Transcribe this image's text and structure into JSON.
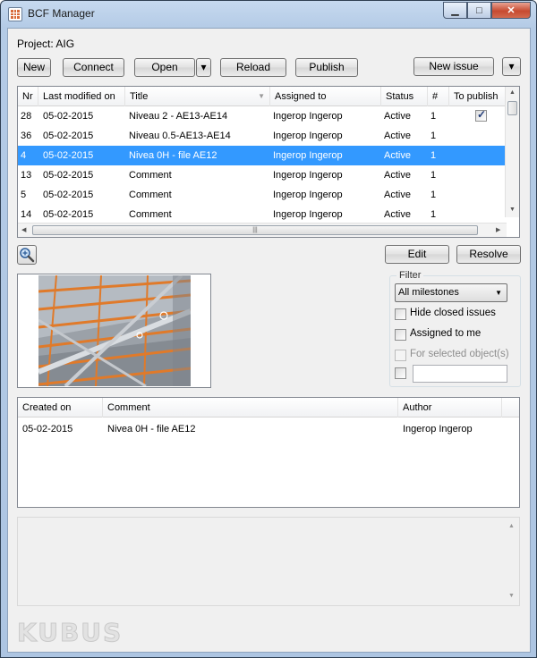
{
  "window": {
    "title": "BCF Manager",
    "icon": "app-grid-icon",
    "controls": {
      "minimize": "▁",
      "maximize": "□",
      "close": "✕"
    }
  },
  "project_label": "Project: AIG",
  "toolbar": {
    "new": "New",
    "connect": "Connect",
    "open": "Open",
    "open_dropdown": "▾",
    "reload": "Reload",
    "publish": "Publish",
    "new_issue": "New issue",
    "more": "▾"
  },
  "issues": {
    "columns": [
      "Nr",
      "Last modified on",
      "Title",
      "Assigned to",
      "Status",
      "#",
      "To publish"
    ],
    "sort_indicator": "▼",
    "rows": [
      {
        "nr": "28",
        "modified": "05-02-2015",
        "title": "Niveau 2 - AE13-AE14",
        "assigned": "Ingerop Ingerop",
        "status": "Active",
        "count": "1",
        "to_publish": true,
        "selected": false
      },
      {
        "nr": "36",
        "modified": "05-02-2015",
        "title": "Niveau 0.5-AE13-AE14",
        "assigned": "Ingerop Ingerop",
        "status": "Active",
        "count": "1",
        "to_publish": false,
        "selected": false
      },
      {
        "nr": "4",
        "modified": "05-02-2015",
        "title": "Nivea 0H - file AE12",
        "assigned": "Ingerop Ingerop",
        "status": "Active",
        "count": "1",
        "to_publish": false,
        "selected": true
      },
      {
        "nr": "13",
        "modified": "05-02-2015",
        "title": "Comment",
        "assigned": "Ingerop Ingerop",
        "status": "Active",
        "count": "1",
        "to_publish": false,
        "selected": false
      },
      {
        "nr": "5",
        "modified": "05-02-2015",
        "title": "Comment",
        "assigned": "Ingerop Ingerop",
        "status": "Active",
        "count": "1",
        "to_publish": false,
        "selected": false
      },
      {
        "nr": "14",
        "modified": "05-02-2015",
        "title": "Comment",
        "assigned": "Ingerop Ingerop",
        "status": "Active",
        "count": "1",
        "to_publish": false,
        "selected": false
      }
    ],
    "hscroll_grip": "|||"
  },
  "actions": {
    "edit": "Edit",
    "resolve": "Resolve"
  },
  "zoom_icon": "zoom-in-icon",
  "filter": {
    "legend": "Filter",
    "milestone_selected": "All milestones",
    "hide_closed": "Hide closed issues",
    "assigned_to_me": "Assigned to me",
    "for_selected_objects": "For selected object(s)",
    "text_filter_value": ""
  },
  "comments": {
    "columns": [
      "Created on",
      "Comment",
      "Author"
    ],
    "rows": [
      {
        "created": "05-02-2015",
        "comment": "Nivea 0H - file AE12",
        "author": "Ingerop Ingerop"
      }
    ]
  },
  "brand": "KUBUS",
  "colors": {
    "selection": "#3399ff",
    "titlebar": "#b9cfe9",
    "close_button": "#c74a30",
    "structure_orange": "#e07a2a"
  }
}
